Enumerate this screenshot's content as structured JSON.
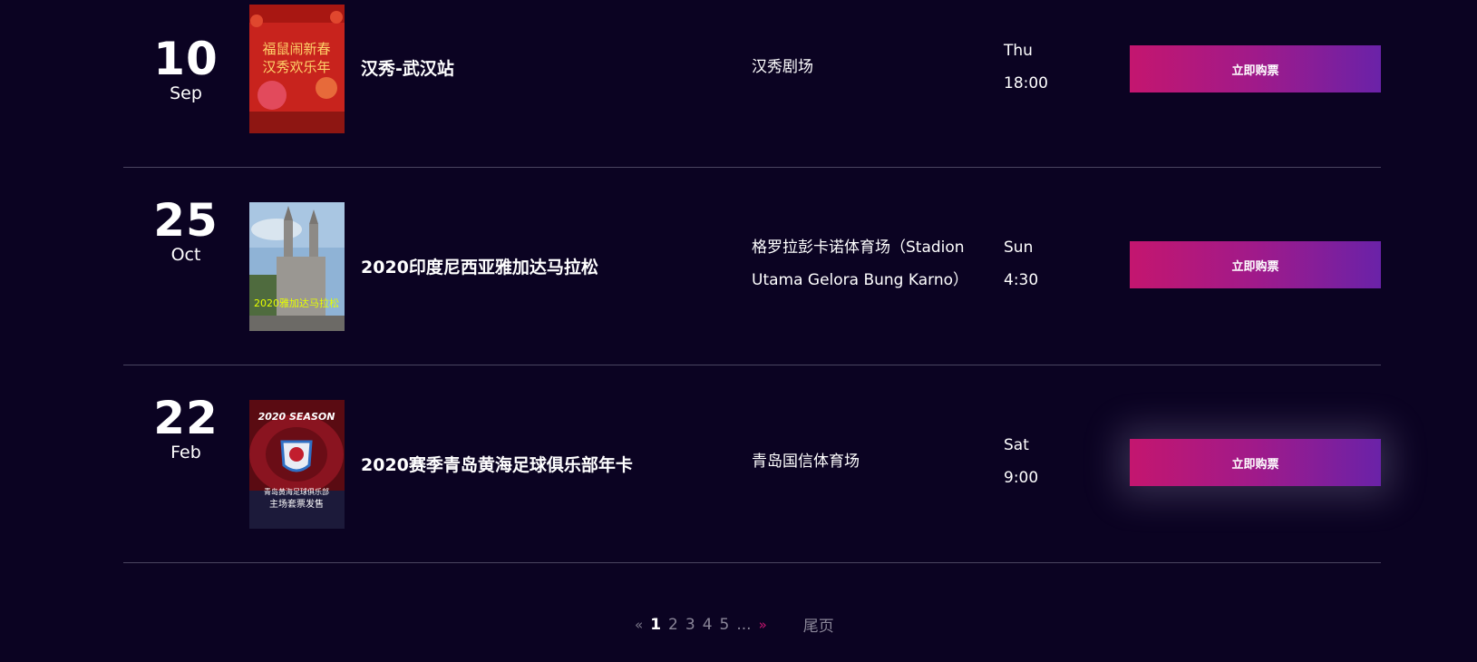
{
  "events": [
    {
      "day": "10",
      "month": "Sep",
      "poster_text": [
        "福鼠闹新春",
        "汉秀欢乐年"
      ],
      "title": "汉秀-武汉站",
      "venue": "汉秀剧场",
      "weekday": "Thu",
      "time": "18:00",
      "button_label": "立即购票"
    },
    {
      "day": "25",
      "month": "Oct",
      "poster_text": [
        "2020雅加达马拉松"
      ],
      "title": "2020印度尼西亚雅加达马拉松",
      "venue": "格罗拉彭卡诺体育场（Stadion Utama Gelora Bung Karno）",
      "weekday": "Sun",
      "time": "4:30",
      "button_label": "立即购票"
    },
    {
      "day": "22",
      "month": "Feb",
      "poster_text": [
        "2020 SEASON",
        "青岛黄海足球俱乐部",
        "主场套票发售"
      ],
      "title": "2020赛季青岛黄海足球俱乐部年卡",
      "venue": "青岛国信体育场",
      "weekday": "Sat",
      "time": "9:00",
      "button_label": "立即购票"
    }
  ],
  "pagination": {
    "prev": "«",
    "pages": [
      "1",
      "2",
      "3",
      "4",
      "5"
    ],
    "current": "1",
    "ellipsis": "...",
    "next": "»",
    "last": "尾页"
  },
  "colors": {
    "background": "#0b0322",
    "button_gradient_start": "#c4166f",
    "button_gradient_end": "#6a22a8",
    "accent": "#c4166f",
    "divider": "#4a4560"
  }
}
